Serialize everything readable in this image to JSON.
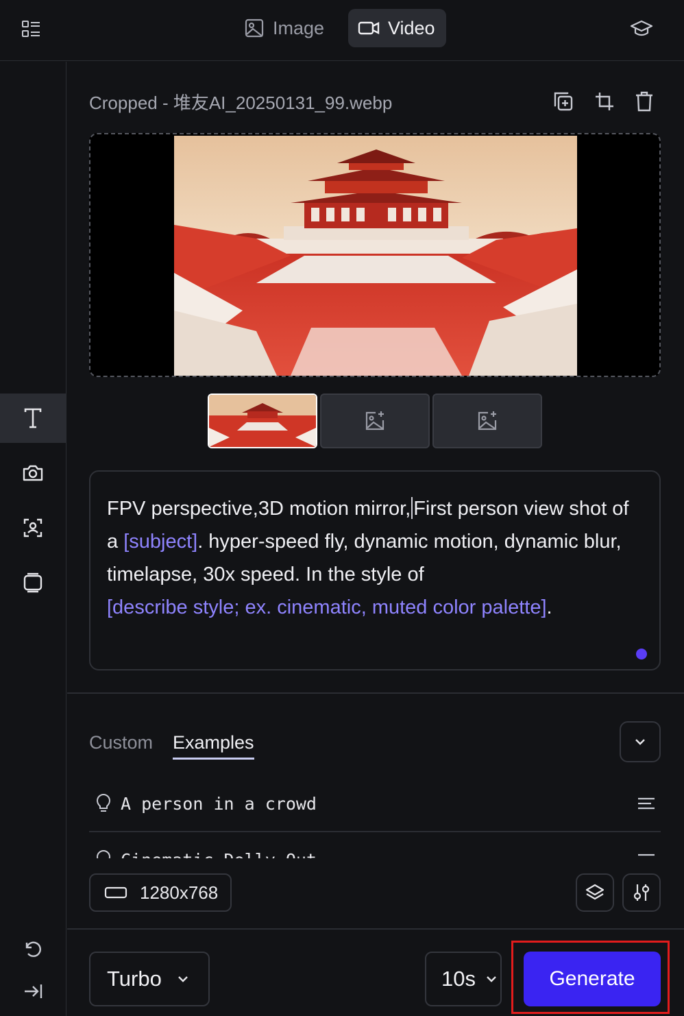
{
  "header": {
    "tabs": [
      {
        "label": "Image",
        "active": false
      },
      {
        "label": "Video",
        "active": true
      }
    ]
  },
  "sidebar": {
    "items": [
      {
        "name": "text",
        "active": true
      },
      {
        "name": "camera",
        "active": false
      },
      {
        "name": "face-scan",
        "active": false
      },
      {
        "name": "frames",
        "active": false
      }
    ]
  },
  "file": {
    "title": "Cropped - 堆友AI_20250131_99.webp"
  },
  "prompt": {
    "part1": "FPV perspective,3D motion mirror,",
    "part2": "First person view shot of a ",
    "placeholder_subject": "[subject]",
    "part3": ". hyper-speed fly, dynamic motion, dynamic blur, timelapse, 30x speed. In the style of ",
    "placeholder_style": "[describe style; ex. cinematic, muted color palette]",
    "part4": "."
  },
  "subtabs": {
    "custom": "Custom",
    "examples": "Examples"
  },
  "examples": [
    {
      "label": "A person in a crowd"
    },
    {
      "label": "Cinematic Dolly Out"
    }
  ],
  "settings": {
    "resolution": "1280x768",
    "model": "Turbo",
    "duration": "10s",
    "generate_label": "Generate"
  },
  "colors": {
    "accent": "#3a24f2",
    "placeholder": "#8f84ff",
    "highlight_outline": "#e21c1c"
  }
}
